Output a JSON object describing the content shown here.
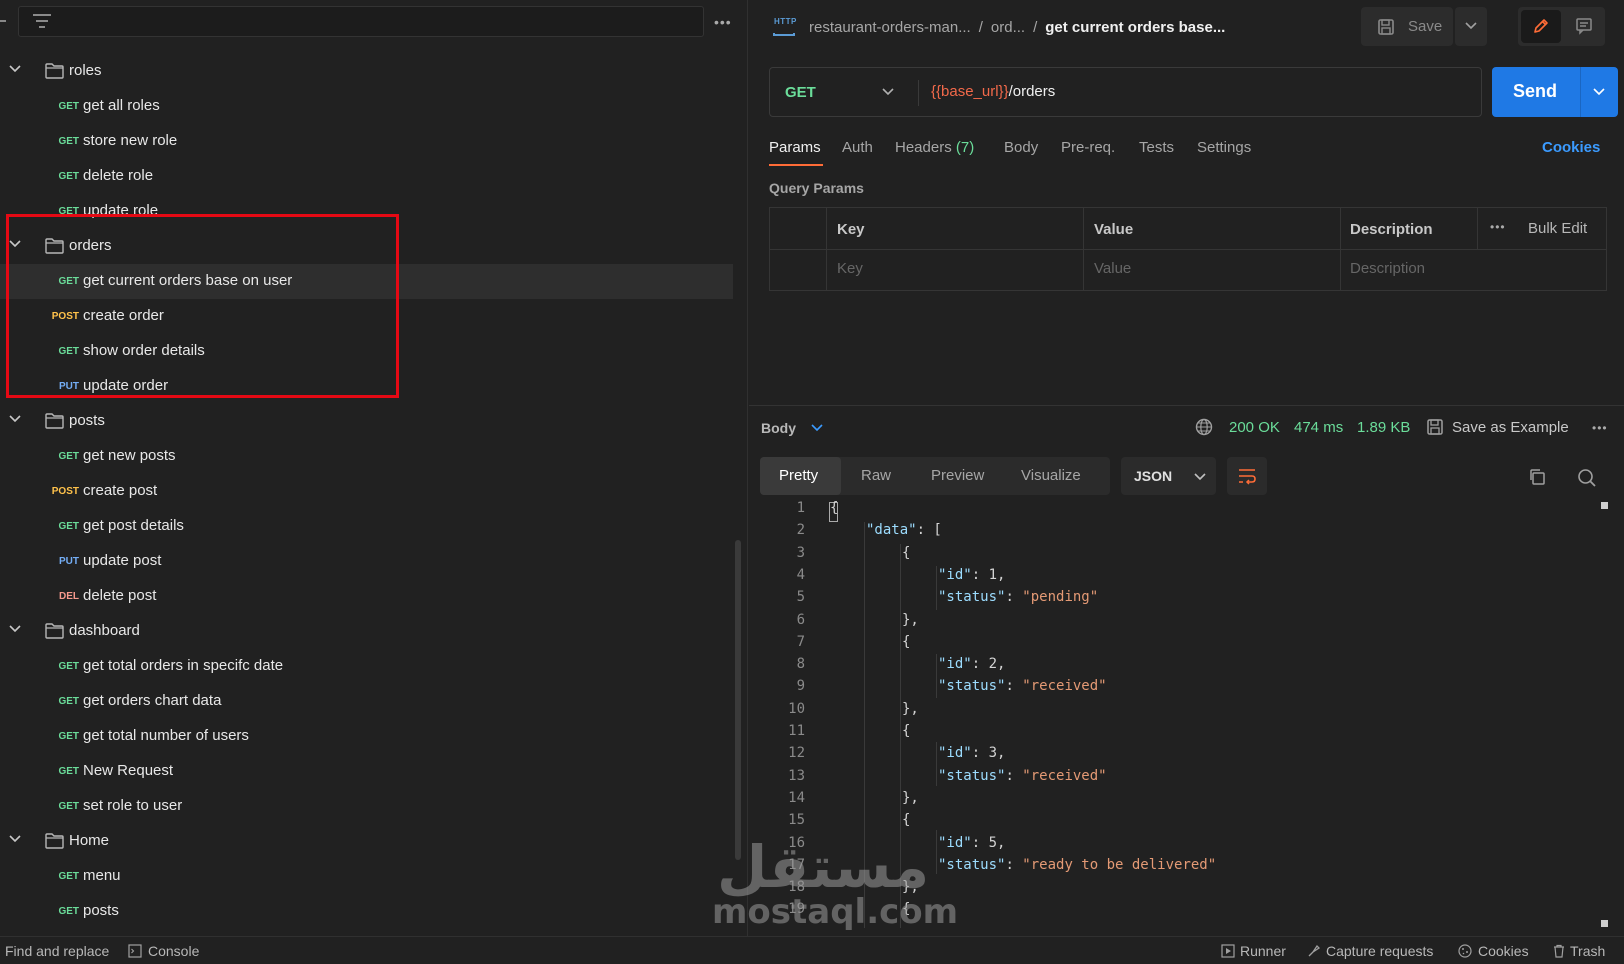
{
  "sidebar": {
    "filter_placeholder": "",
    "more": "•••",
    "tree": [
      {
        "type": "folder",
        "name": "roles"
      },
      {
        "type": "request",
        "method": "GET",
        "name": "get all roles"
      },
      {
        "type": "request",
        "method": "GET",
        "name": "store new role"
      },
      {
        "type": "request",
        "method": "GET",
        "name": "delete role"
      },
      {
        "type": "request",
        "method": "GET",
        "name": "update role"
      },
      {
        "type": "folder",
        "name": "orders"
      },
      {
        "type": "request",
        "method": "GET",
        "name": "get current orders base on user",
        "selected": true
      },
      {
        "type": "request",
        "method": "POST",
        "name": "create order"
      },
      {
        "type": "request",
        "method": "GET",
        "name": "show order details"
      },
      {
        "type": "request",
        "method": "PUT",
        "name": "update order"
      },
      {
        "type": "folder",
        "name": "posts"
      },
      {
        "type": "request",
        "method": "GET",
        "name": "get new posts"
      },
      {
        "type": "request",
        "method": "POST",
        "name": "create post"
      },
      {
        "type": "request",
        "method": "GET",
        "name": "get post details"
      },
      {
        "type": "request",
        "method": "PUT",
        "name": "update post"
      },
      {
        "type": "request",
        "method": "DEL",
        "name": "delete post"
      },
      {
        "type": "folder",
        "name": "dashboard"
      },
      {
        "type": "request",
        "method": "GET",
        "name": "get total orders in specifc date"
      },
      {
        "type": "request",
        "method": "GET",
        "name": "get orders chart data"
      },
      {
        "type": "request",
        "method": "GET",
        "name": "get total number of users"
      },
      {
        "type": "request",
        "method": "GET",
        "name": "New Request"
      },
      {
        "type": "request",
        "method": "GET",
        "name": "set role to user"
      },
      {
        "type": "folder",
        "name": "Home"
      },
      {
        "type": "request",
        "method": "GET",
        "name": "menu"
      },
      {
        "type": "request",
        "method": "GET",
        "name": "posts"
      }
    ]
  },
  "header": {
    "http_icon": "HTTP",
    "breadcrumb": {
      "collection": "restaurant-orders-man...",
      "folder": "ord...",
      "current": "get current orders base..."
    },
    "save_label": "Save"
  },
  "request": {
    "method": "GET",
    "url_var": "{{base_url}}",
    "url_path": "/orders",
    "send_label": "Send",
    "tabs": {
      "params": "Params",
      "auth": "Auth",
      "headers": "Headers",
      "headers_count": "(7)",
      "body": "Body",
      "prereq": "Pre-req.",
      "tests": "Tests",
      "settings": "Settings",
      "cookies": "Cookies"
    },
    "query_params": {
      "title": "Query Params",
      "columns": {
        "key": "Key",
        "value": "Value",
        "description": "Description"
      },
      "placeholders": {
        "key": "Key",
        "value": "Value",
        "description": "Description"
      },
      "more": "•••",
      "bulk_edit": "Bulk Edit"
    }
  },
  "response": {
    "body_label": "Body",
    "status": "200 OK",
    "time": "474 ms",
    "size": "1.89 KB",
    "save_example": "Save as Example",
    "more": "•••",
    "view_tabs": {
      "pretty": "Pretty",
      "raw": "Raw",
      "preview": "Preview",
      "visualize": "Visualize"
    },
    "format": "JSON",
    "code_lines": [
      {
        "n": "1",
        "indent": 0,
        "parts": [
          [
            "n",
            "{"
          ]
        ]
      },
      {
        "n": "2",
        "indent": 1,
        "parts": [
          [
            "k",
            "\"data\""
          ],
          [
            "n",
            ": ["
          ]
        ]
      },
      {
        "n": "3",
        "indent": 2,
        "parts": [
          [
            "n",
            "{"
          ]
        ]
      },
      {
        "n": "4",
        "indent": 3,
        "parts": [
          [
            "k",
            "\"id\""
          ],
          [
            "n",
            ": 1,"
          ]
        ]
      },
      {
        "n": "5",
        "indent": 3,
        "parts": [
          [
            "k",
            "\"status\""
          ],
          [
            "n",
            ": "
          ],
          [
            "s",
            "\"pending\""
          ]
        ]
      },
      {
        "n": "6",
        "indent": 2,
        "parts": [
          [
            "n",
            "},"
          ]
        ]
      },
      {
        "n": "7",
        "indent": 2,
        "parts": [
          [
            "n",
            "{"
          ]
        ]
      },
      {
        "n": "8",
        "indent": 3,
        "parts": [
          [
            "k",
            "\"id\""
          ],
          [
            "n",
            ": 2,"
          ]
        ]
      },
      {
        "n": "9",
        "indent": 3,
        "parts": [
          [
            "k",
            "\"status\""
          ],
          [
            "n",
            ": "
          ],
          [
            "s",
            "\"received\""
          ]
        ]
      },
      {
        "n": "10",
        "indent": 2,
        "parts": [
          [
            "n",
            "},"
          ]
        ]
      },
      {
        "n": "11",
        "indent": 2,
        "parts": [
          [
            "n",
            "{"
          ]
        ]
      },
      {
        "n": "12",
        "indent": 3,
        "parts": [
          [
            "k",
            "\"id\""
          ],
          [
            "n",
            ": 3,"
          ]
        ]
      },
      {
        "n": "13",
        "indent": 3,
        "parts": [
          [
            "k",
            "\"status\""
          ],
          [
            "n",
            ": "
          ],
          [
            "s",
            "\"received\""
          ]
        ]
      },
      {
        "n": "14",
        "indent": 2,
        "parts": [
          [
            "n",
            "},"
          ]
        ]
      },
      {
        "n": "15",
        "indent": 2,
        "parts": [
          [
            "n",
            "{"
          ]
        ]
      },
      {
        "n": "16",
        "indent": 3,
        "parts": [
          [
            "k",
            "\"id\""
          ],
          [
            "n",
            ": 5,"
          ]
        ]
      },
      {
        "n": "17",
        "indent": 3,
        "parts": [
          [
            "k",
            "\"status\""
          ],
          [
            "n",
            ": "
          ],
          [
            "s",
            "\"ready to be delivered\""
          ]
        ]
      },
      {
        "n": "18",
        "indent": 2,
        "parts": [
          [
            "n",
            "},"
          ]
        ]
      },
      {
        "n": "19",
        "indent": 2,
        "parts": [
          [
            "n",
            "{"
          ]
        ]
      }
    ]
  },
  "watermark": {
    "arabic": "مستقل",
    "latin": "mostaql.com"
  },
  "status_bar": {
    "find_replace": "Find and replace",
    "console": "Console",
    "runner": "Runner",
    "capture": "Capture requests",
    "cookies": "Cookies",
    "trash": "Trash"
  },
  "colors": {
    "get": "#6bdd9a",
    "post": "#ffc24b",
    "put": "#74aef6",
    "del": "#f79a8e",
    "accent": "#ff6c37",
    "send": "#1f79e5",
    "highlight": "#e50914"
  }
}
